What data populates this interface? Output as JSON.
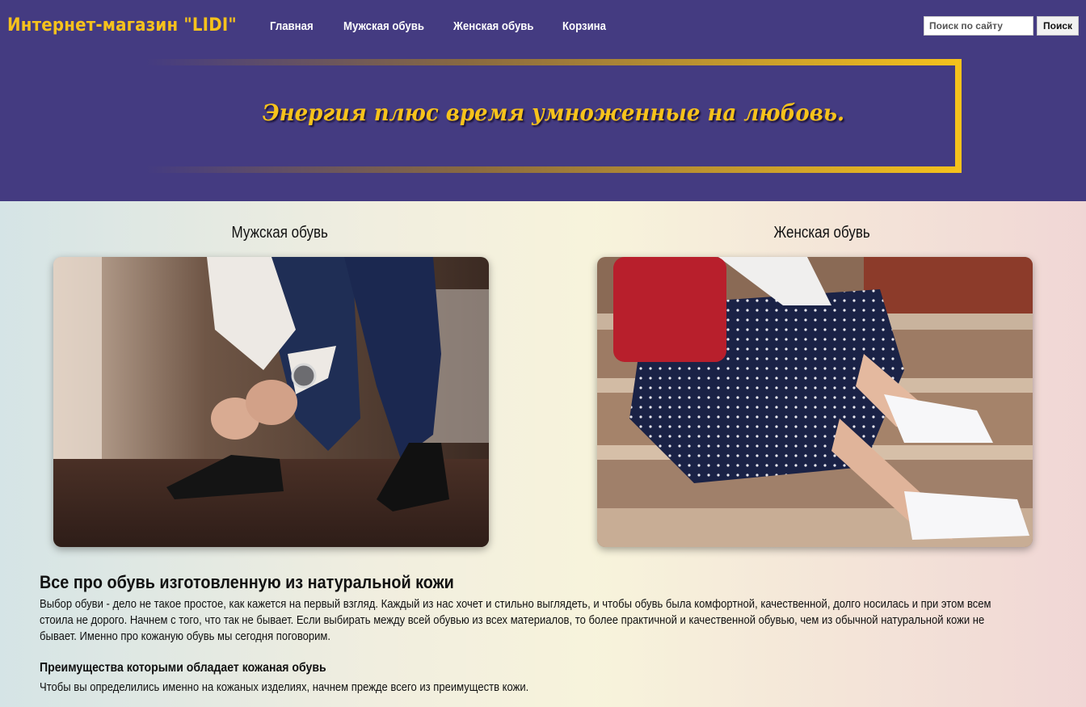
{
  "header": {
    "brand": "Интернет-магазин \"LIDI\"",
    "nav": [
      {
        "label": "Главная"
      },
      {
        "label": "Мужская обувь"
      },
      {
        "label": "Женская обувь"
      },
      {
        "label": "Корзина"
      }
    ],
    "search": {
      "placeholder": "Поиск по сайту",
      "button_label": "Поиск"
    },
    "slogan": "Энергия плюс время умноженные на любовь."
  },
  "categories": [
    {
      "title": "Мужская обувь",
      "image": "men-shoes-photo"
    },
    {
      "title": "Женская обувь",
      "image": "women-shoes-photo"
    }
  ],
  "article": {
    "title": "Все про обувь изготовленную из натуральной кожи",
    "paragraph": "Выбор обуви - дело не такое простое, как кажется на первый взгляд. Каждый из нас хочет и стильно выглядеть, и чтобы обувь была комфортной, качественной, долго носилась и при этом всем стоила не дорого. Начнем с того, что так не бывает. Если выбирать между всей обувью из всех материалов, то более практичной и качественной обувью, чем из обычной натуральной кожи не бывает. Именно про кожаную обувь мы сегодня поговорим.",
    "subtitle": "Преимущества которыми обладает кожаная обувь",
    "subparagraph": "Чтобы вы определились именно на кожаных изделиях, начнем прежде всего из преимуществ кожи."
  },
  "colors": {
    "header_bg": "#443b81",
    "accent": "#f6c21c"
  }
}
